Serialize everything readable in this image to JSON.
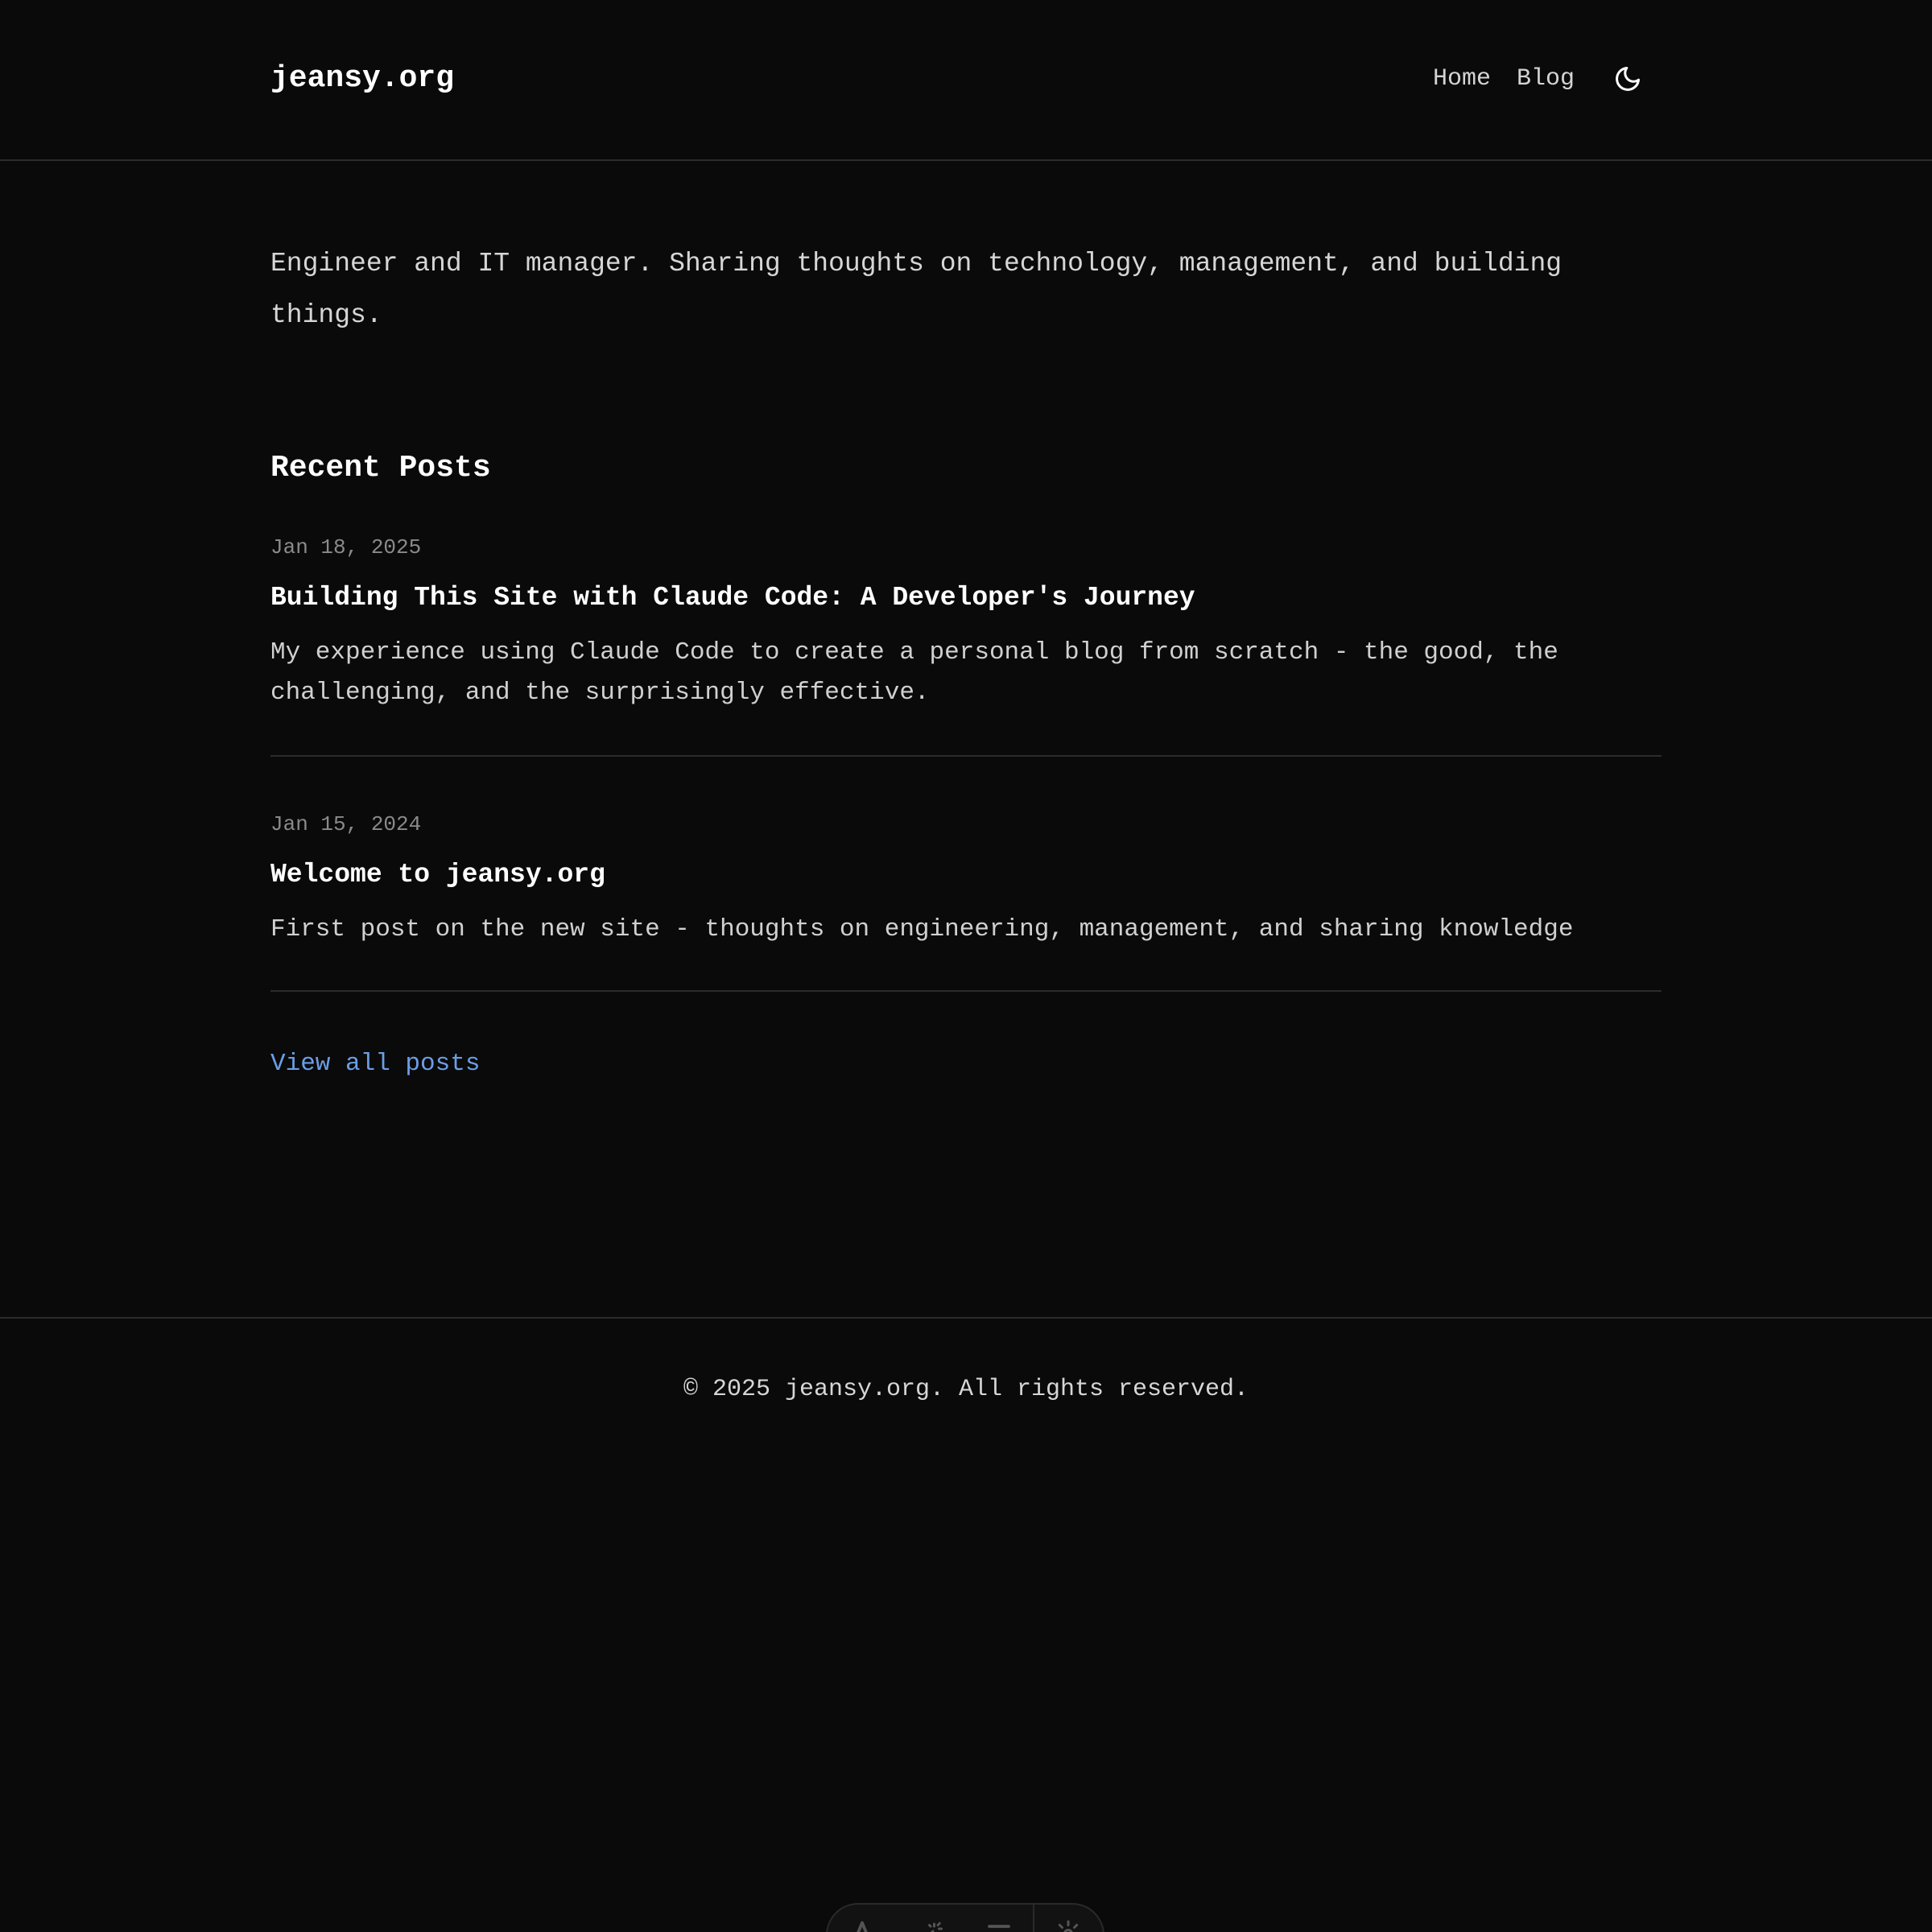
{
  "site": {
    "title": "jeansy.org"
  },
  "nav": {
    "items": [
      {
        "label": "Home"
      },
      {
        "label": "Blog"
      }
    ],
    "theme_toggle_icon": "moon-icon"
  },
  "intro": {
    "text": "Engineer and IT manager. Sharing thoughts on technology, management, and building things."
  },
  "recent_posts": {
    "heading": "Recent Posts",
    "posts": [
      {
        "date": "Jan 18, 2025",
        "title": "Building This Site with Claude Code: A Developer's Journey",
        "excerpt": "My experience using Claude Code to create a personal blog from scratch - the good, the challenging, and the surprisingly effective."
      },
      {
        "date": "Jan 15, 2024",
        "title": "Welcome to jeansy.org",
        "excerpt": "First post on the new site - thoughts on engineering, management, and sharing knowledge"
      }
    ],
    "view_all_label": "View all posts"
  },
  "footer": {
    "copyright": "© 2025 jeansy.org. All rights reserved."
  },
  "toolbar": {
    "icons": [
      "text-icon",
      "magic-wand-icon",
      "menu-icon",
      "gear-icon"
    ]
  },
  "colors": {
    "background": "#0a0a0a",
    "text": "#e5e5e5",
    "muted": "#8a8a8a",
    "link": "#6b9ee6",
    "divider": "#2c2c2c"
  }
}
